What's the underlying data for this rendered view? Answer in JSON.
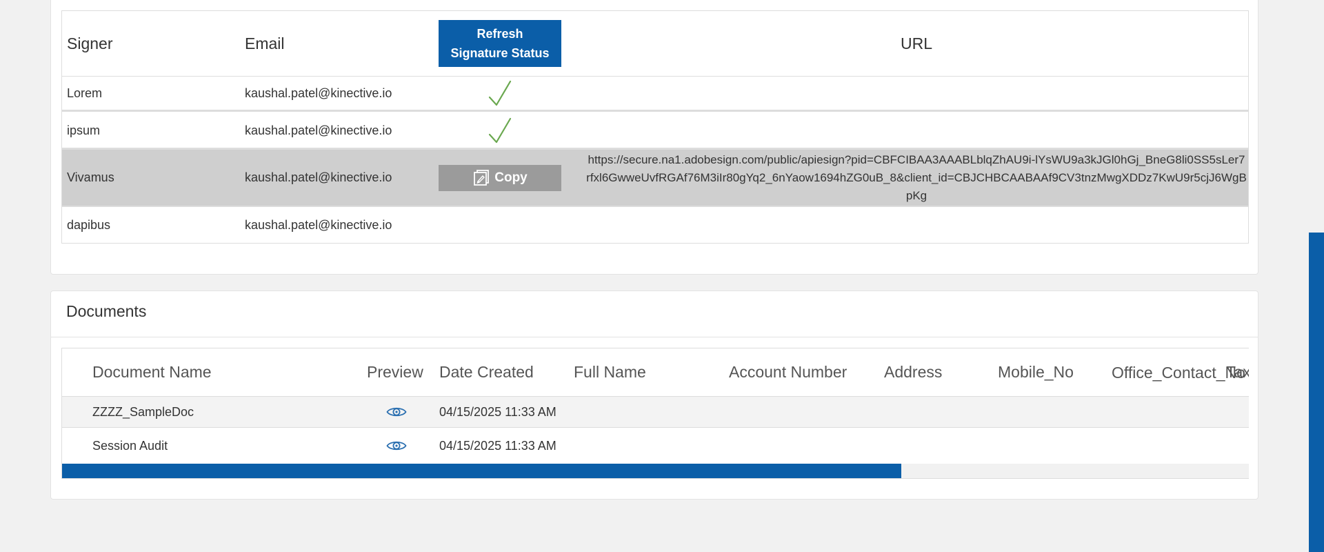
{
  "signers": {
    "headers": {
      "signer": "Signer",
      "email": "Email",
      "url": "URL"
    },
    "refresh_button": {
      "line1": "Refresh",
      "line2": "Signature Status"
    },
    "copy_label": "Copy",
    "rows": [
      {
        "signer": "Lorem",
        "email": "kaushal.patel@kinective.io",
        "status": "signed",
        "url": ""
      },
      {
        "signer": "ipsum",
        "email": "kaushal.patel@kinective.io",
        "status": "signed",
        "url": ""
      },
      {
        "signer": "Vivamus",
        "email": "kaushal.patel@kinective.io",
        "status": "pending",
        "url": "https://secure.na1.adobesign.com/public/apiesign?pid=CBFCIBAA3AAABLblqZhAU9i-lYsWU9a3kJGl0hGj_BneG8li0SS5sLer7rfxl6GwweUvfRGAf76M3iIr80gYq2_6nYaow1694hZG0uB_8&client_id=CBJCHBCAABAAf9CV3tnzMwgXDDz7KwU9r5cjJ6WgBpKg"
      },
      {
        "signer": "dapibus",
        "email": "kaushal.patel@kinective.io",
        "status": "none",
        "url": ""
      }
    ]
  },
  "documents": {
    "title": "Documents",
    "columns": {
      "name": "Document Name",
      "preview": "Preview",
      "date": "Date Created",
      "full_name": "Full Name",
      "account": "Account Number",
      "address": "Address",
      "mobile": "Mobile_No",
      "office": "Office_Contact_No",
      "tax": "Tax"
    },
    "rows": [
      {
        "name": "ZZZZ_SampleDoc",
        "date": "04/15/2025 11:33 AM"
      },
      {
        "name": "Session Audit",
        "date": "04/15/2025 11:33 AM"
      }
    ],
    "horizontal_scroll_fraction": 0.707
  },
  "colors": {
    "accent": "#0b5ea8",
    "check": "#6aa84f",
    "highlight_row": "#cfcfcf",
    "copy_button": "#9b9b9b"
  },
  "icons": [
    "checkmark-icon",
    "copy-icon",
    "eye-icon"
  ]
}
